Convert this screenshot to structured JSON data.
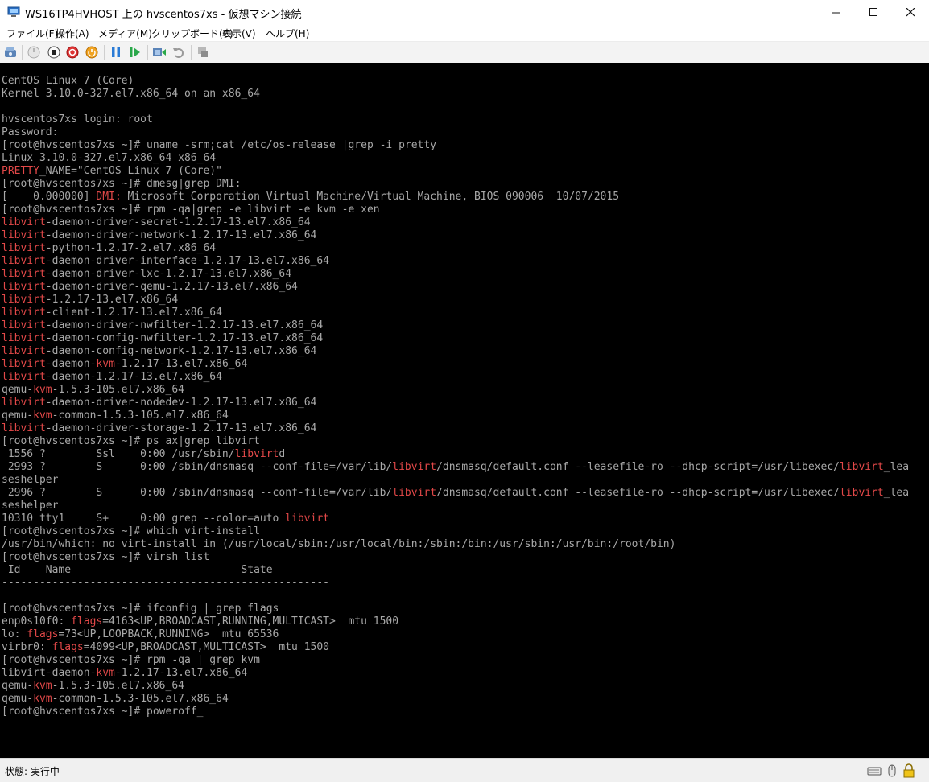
{
  "window": {
    "title": "WS16TP4HVHOST 上の hvscentos7xs - 仮想マシン接続",
    "minimize": "—",
    "maximize": "☐",
    "close": "✕"
  },
  "menu": [
    "ファイル(F)",
    "操作(A)",
    "メディア(M)",
    "クリップボード(C)",
    "表示(V)",
    "ヘルプ(H)"
  ],
  "toolbar_icons": [
    "ctrl-alt-del-icon",
    "start-icon",
    "turn-off-icon",
    "shutdown-icon",
    "save-icon",
    "pause-icon",
    "resume-icon",
    "checkpoint-icon",
    "revert-icon",
    "enhanced-session-icon"
  ],
  "console": {
    "lines": [
      "CentOS Linux 7 (Core)",
      "Kernel 3.10.0-327.el7.x86_64 on an x86_64",
      "",
      "hvscentos7xs login: root",
      "Password:",
      "[root@hvscentos7xs ~]# uname -srm;cat /etc/os-release |grep -i pretty",
      "Linux 3.10.0-327.el7.x86_64 x86_64",
      "{PRETTY}_NAME=\"CentOS Linux 7 (Core)\"",
      "[root@hvscentos7xs ~]# dmesg|grep DMI:",
      "[    0.000000] {DMI:} Microsoft Corporation Virtual Machine/Virtual Machine, BIOS 090006  10/07/2015",
      "[root@hvscentos7xs ~]# rpm -qa|grep -e libvirt -e kvm -e xen",
      "{libvirt}-daemon-driver-secret-1.2.17-13.el7.x86_64",
      "{libvirt}-daemon-driver-network-1.2.17-13.el7.x86_64",
      "{libvirt}-python-1.2.17-2.el7.x86_64",
      "{libvirt}-daemon-driver-interface-1.2.17-13.el7.x86_64",
      "{libvirt}-daemon-driver-lxc-1.2.17-13.el7.x86_64",
      "{libvirt}-daemon-driver-qemu-1.2.17-13.el7.x86_64",
      "{libvirt}-1.2.17-13.el7.x86_64",
      "{libvirt}-client-1.2.17-13.el7.x86_64",
      "{libvirt}-daemon-driver-nwfilter-1.2.17-13.el7.x86_64",
      "{libvirt}-daemon-config-nwfilter-1.2.17-13.el7.x86_64",
      "{libvirt}-daemon-config-network-1.2.17-13.el7.x86_64",
      "{libvirt}-daemon-{kvm}-1.2.17-13.el7.x86_64",
      "{libvirt}-daemon-1.2.17-13.el7.x86_64",
      "qemu-{kvm}-1.5.3-105.el7.x86_64",
      "{libvirt}-daemon-driver-nodedev-1.2.17-13.el7.x86_64",
      "qemu-{kvm}-common-1.5.3-105.el7.x86_64",
      "{libvirt}-daemon-driver-storage-1.2.17-13.el7.x86_64",
      "[root@hvscentos7xs ~]# ps ax|grep libvirt",
      " 1556 ?        Ssl    0:00 /usr/sbin/{libvirt}d",
      " 2993 ?        S      0:00 /sbin/dnsmasq --conf-file=/var/lib/{libvirt}/dnsmasq/default.conf --leasefile-ro --dhcp-script=/usr/libexec/{libvirt}_lea",
      "seshelper",
      " 2996 ?        S      0:00 /sbin/dnsmasq --conf-file=/var/lib/{libvirt}/dnsmasq/default.conf --leasefile-ro --dhcp-script=/usr/libexec/{libvirt}_lea",
      "seshelper",
      "10310 tty1     S+     0:00 grep --color=auto {libvirt}",
      "[root@hvscentos7xs ~]# which virt-install",
      "/usr/bin/which: no virt-install in (/usr/local/sbin:/usr/local/bin:/sbin:/bin:/usr/sbin:/usr/bin:/root/bin)",
      "[root@hvscentos7xs ~]# virsh list",
      " Id    Name                           State",
      "----------------------------------------------------",
      "",
      "[root@hvscentos7xs ~]# ifconfig | grep flags",
      "enp0s10f0: {flags}=4163<UP,BROADCAST,RUNNING,MULTICAST>  mtu 1500",
      "lo: {flags}=73<UP,LOOPBACK,RUNNING>  mtu 65536",
      "virbr0: {flags}=4099<UP,BROADCAST,MULTICAST>  mtu 1500",
      "[root@hvscentos7xs ~]# rpm -qa | grep kvm",
      "libvirt-daemon-{kvm}-1.2.17-13.el7.x86_64",
      "qemu-{kvm}-1.5.3-105.el7.x86_64",
      "qemu-{kvm}-common-1.5.3-105.el7.x86_64",
      "[root@hvscentos7xs ~]# poweroff"
    ],
    "cursor": "_",
    "text_color": "#a8a8a8",
    "highlight_color": "#e24848",
    "background": "#000000"
  },
  "status": {
    "text": "状態: 実行中",
    "icons": [
      "keyboard-icon",
      "mouse-icon",
      "lock-icon"
    ]
  }
}
